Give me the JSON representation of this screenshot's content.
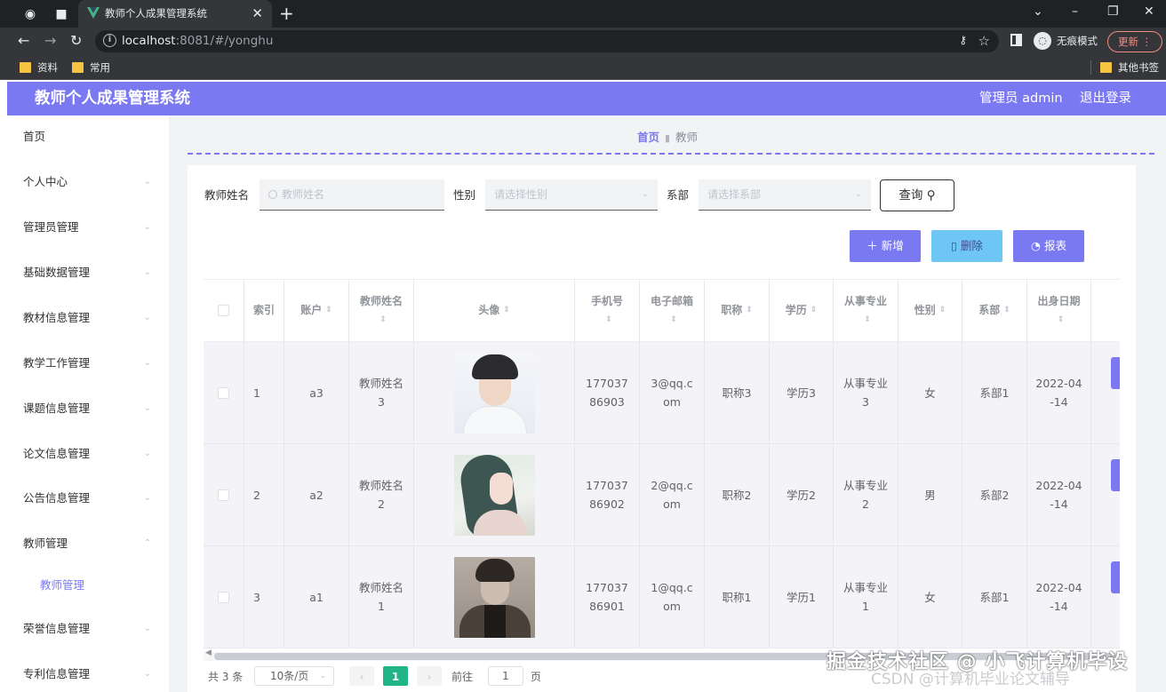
{
  "browser": {
    "tab_title": "教师个人成果管理系统",
    "url_host": "localhost",
    "url_rest": ":8081/#/yonghu",
    "incognito_label": "无痕模式",
    "update_label": "更新",
    "bookmarks": [
      "资料",
      "常用"
    ],
    "other_bookmarks": "其他书签"
  },
  "header": {
    "title": "教师个人成果管理系统",
    "user": "管理员 admin",
    "logout": "退出登录",
    "accent_color": "#7b79f2"
  },
  "sidebar": {
    "items": [
      {
        "label": "首页"
      },
      {
        "label": "个人中心"
      },
      {
        "label": "管理员管理"
      },
      {
        "label": "基础数据管理"
      },
      {
        "label": "教材信息管理"
      },
      {
        "label": "教学工作管理"
      },
      {
        "label": "课题信息管理"
      },
      {
        "label": "论文信息管理"
      },
      {
        "label": "公告信息管理"
      },
      {
        "label": "教师管理"
      },
      {
        "label": "教师管理"
      },
      {
        "label": "荣誉信息管理"
      },
      {
        "label": "专利信息管理"
      }
    ]
  },
  "breadcrumb": {
    "home": "首页",
    "current": "教师"
  },
  "search": {
    "name_label": "教师姓名",
    "name_placeholder": "教师姓名",
    "gender_label": "性别",
    "gender_placeholder": "请选择性别",
    "dept_label": "系部",
    "dept_placeholder": "请选择系部",
    "query_label": "查询"
  },
  "actions": {
    "add": "新增",
    "delete": "删除",
    "report": "报表"
  },
  "table": {
    "headers": {
      "index": "索引",
      "account": "账户",
      "name": "教师姓名",
      "avatar": "头像",
      "phone": "手机号",
      "email": "电子邮箱",
      "title": "职称",
      "education": "学历",
      "major": "从事专业",
      "gender": "性别",
      "dept": "系部",
      "birth": "出身日期"
    },
    "rows": [
      {
        "index": "1",
        "account": "a3",
        "name": "教师姓名3",
        "phone": "17703786903",
        "email": "3@qq.com",
        "title": "职称3",
        "education": "学历3",
        "major": "从事专业3",
        "gender": "女",
        "dept": "系部1",
        "birth": "2022-04-14"
      },
      {
        "index": "2",
        "account": "a2",
        "name": "教师姓名2",
        "phone": "17703786902",
        "email": "2@qq.com",
        "title": "职称2",
        "education": "学历2",
        "major": "从事专业2",
        "gender": "男",
        "dept": "系部2",
        "birth": "2022-04-14"
      },
      {
        "index": "3",
        "account": "a1",
        "name": "教师姓名1",
        "phone": "17703786901",
        "email": "1@qq.com",
        "title": "职称1",
        "education": "学历1",
        "major": "从事专业1",
        "gender": "女",
        "dept": "系部1",
        "birth": "2022-04-14"
      }
    ]
  },
  "pagination": {
    "total": "共 3 条",
    "page_size": "10条/页",
    "current_page": "1",
    "goto_label": "前往",
    "goto_value": "1",
    "page_suffix": "页"
  },
  "watermark": {
    "line1": "掘金技术社区 @ 小飞计算机毕设",
    "line2": "CSDN @计算机毕业论文辅导"
  }
}
